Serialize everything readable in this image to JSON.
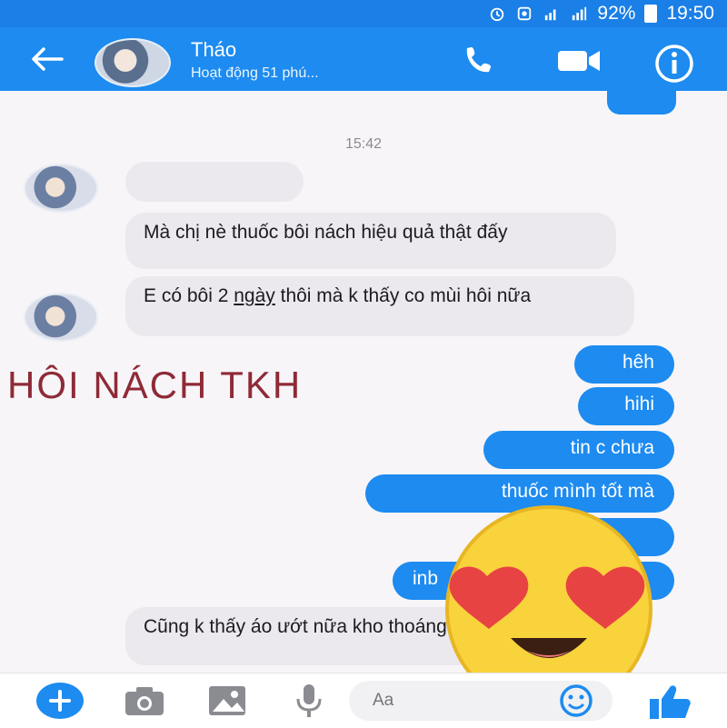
{
  "status_bar": {
    "battery": "92%",
    "time": "19:50"
  },
  "header": {
    "contact_name": "Tháo",
    "contact_status": "Hoạt động 51 phú..."
  },
  "chat": {
    "timestamp": "15:42",
    "incoming": [
      {
        "text": "Mà chị nè thuốc bôi nách hiệu quả thật đấy"
      },
      {
        "text_before": "E có bôi 2 ",
        "text_underlined": "ngày",
        "text_after": " thôi mà k thấy co mùi hôi nữa"
      },
      {
        "text": "Cũng k thấy áo ướt nữa kho thoáng hẳn"
      }
    ],
    "outgoing": [
      {
        "text": "hêh"
      },
      {
        "text": "hihi"
      },
      {
        "text": "tin c chưa"
      },
      {
        "text": "thuốc mình tốt mà"
      },
      {
        "text": "inb"
      }
    ],
    "overlay_caption": "HÔI NÁCH TKH"
  },
  "composer": {
    "placeholder": "Aa"
  },
  "colors": {
    "accent": "#1d8bf0",
    "incoming_bubble": "#ece9ee",
    "caption": "#8e2a37"
  },
  "icons": [
    "back-arrow-icon",
    "phone-icon",
    "video-camera-icon",
    "info-icon",
    "plus-icon",
    "camera-icon",
    "image-icon",
    "microphone-icon",
    "emoji-icon",
    "thumbs-up-icon",
    "heart-eyes-emoji"
  ]
}
